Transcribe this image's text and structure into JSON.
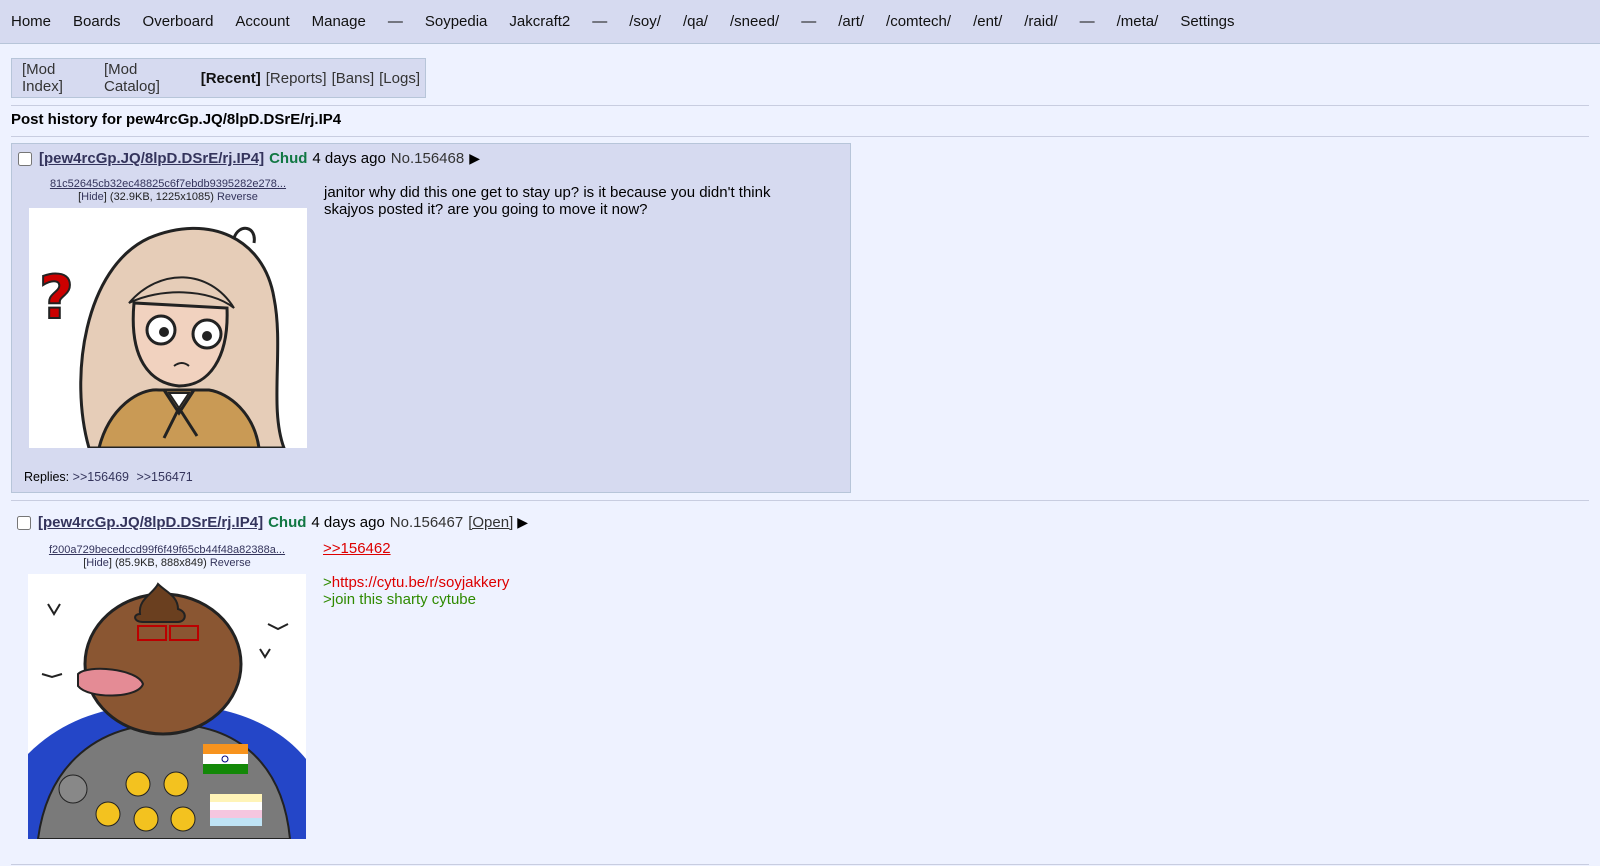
{
  "nav": {
    "items": [
      "Home",
      "Boards",
      "Overboard",
      "Account",
      "Manage",
      "—",
      "Soypedia",
      "Jakcraft2",
      "—",
      "/soy/",
      "/qa/",
      "/sneed/",
      "—",
      "/art/",
      "/comtech/",
      "/ent/",
      "/raid/",
      "—",
      "/meta/",
      "Settings"
    ]
  },
  "modbar": {
    "mod_index": "[Mod Index]",
    "mod_catalog": "[Mod Catalog]",
    "recent": "[Recent]",
    "reports": "[Reports]",
    "bans": "[Bans]",
    "logs": "[Logs]"
  },
  "history_title": "Post history for pew4rcGp.JQ/8lpD.DSrE/rj.IP4",
  "posts": [
    {
      "poster_id": "[pew4rcGp.JQ/8lpD.DSrE/rj.IP4]",
      "name": "Chud",
      "time": "4 days ago",
      "no": "No.156468",
      "arrow": "▶",
      "file_name": "81c52645cb32ec48825c6f7ebdb9395282e278...",
      "hide": "Hide",
      "file_meta": "(32.9KB, 1225x1085)",
      "reverse": "Reverse",
      "body_line1": "janitor why did this one get to stay up? is it because you didn't think",
      "body_line2": "skajyos posted it? are you going to move it now?",
      "replies_label": "Replies:",
      "reply1": ">>156469",
      "reply2": ">>156471"
    },
    {
      "poster_id": "[pew4rcGp.JQ/8lpD.DSrE/rj.IP4]",
      "name": "Chud",
      "time": "4 days ago",
      "no": "No.156467",
      "open": "[Open]",
      "arrow": "▶",
      "file_name": "f200a729becedccd99f6f49f65cb44f48a82388a...",
      "hide": "Hide",
      "file_meta": "(85.9KB, 888x849)",
      "reverse": "Reverse",
      "quote": ">>156462",
      "green1_prefix": ">",
      "green1_link": "https://cytu.be/r/soyjakkery",
      "green2": ">join this sharty cytube"
    }
  ]
}
